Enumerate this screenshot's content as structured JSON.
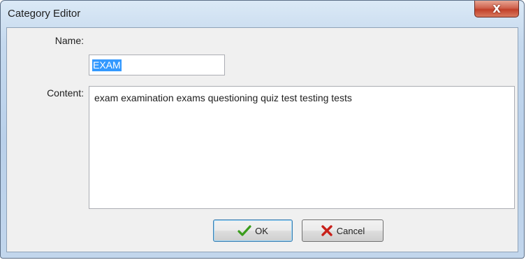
{
  "window": {
    "title": "Category Editor",
    "close_glyph": "X"
  },
  "form": {
    "name_label": "Name:",
    "name_value": "EXAM",
    "content_label": "Content:",
    "content_value": "exam examination exams questioning quiz test testing tests"
  },
  "buttons": {
    "ok_label": "OK",
    "ok_icon": "checkmark-icon",
    "cancel_label": "Cancel",
    "cancel_icon": "x-mark-icon"
  },
  "colors": {
    "selection": "#3399ff",
    "checkmark": "#3a9c1c",
    "cancel_x": "#c8201a"
  }
}
